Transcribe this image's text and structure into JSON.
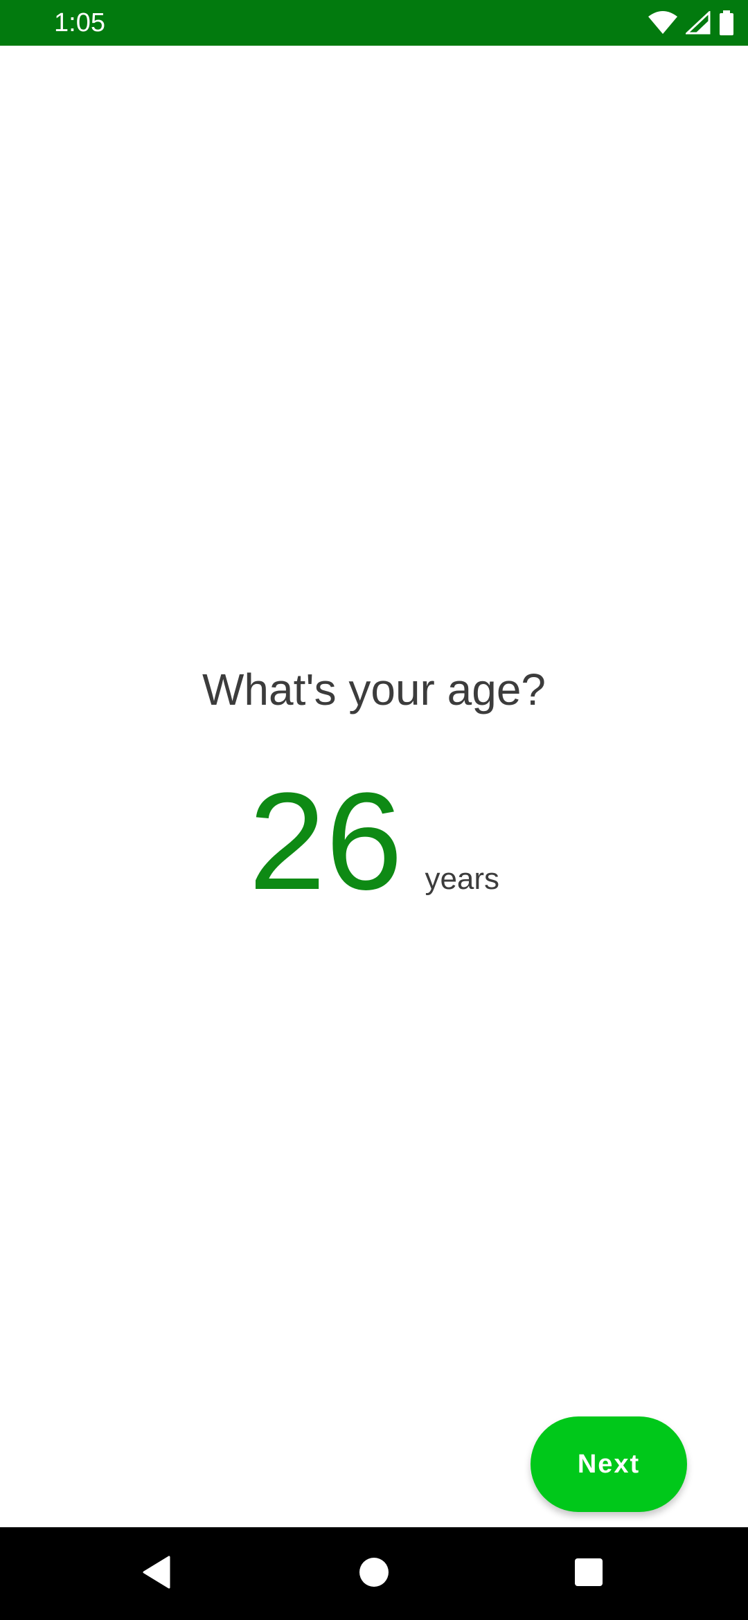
{
  "status_bar": {
    "time": "1:05",
    "icons": [
      "wifi-icon",
      "cell-signal-icon",
      "battery-icon"
    ],
    "background_color": "#027a0e"
  },
  "question": {
    "text": "What's your age?"
  },
  "age": {
    "value": "26",
    "unit": "years",
    "value_color": "#0e8a14"
  },
  "next_button": {
    "label": "Next",
    "color": "#00c81a"
  },
  "nav_bar": {
    "icons": [
      "back-icon",
      "home-icon",
      "recents-icon"
    ]
  }
}
